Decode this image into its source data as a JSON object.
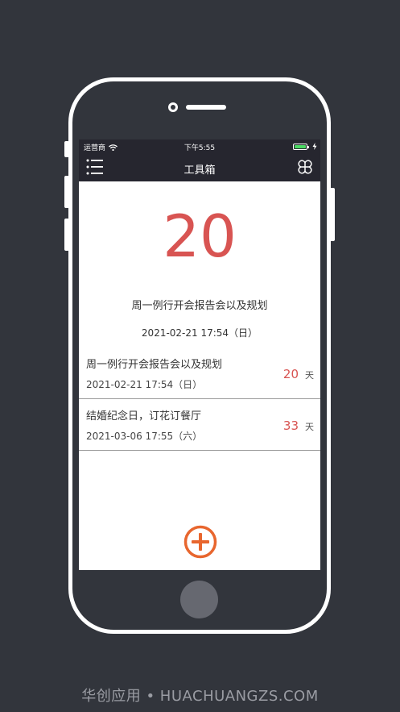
{
  "status_bar": {
    "carrier": "运营商",
    "time": "下午5:55",
    "battery_color": "#4cd964"
  },
  "nav_bar": {
    "title": "工具箱",
    "left_icon": "menu-icon",
    "right_icon": "grid-icon"
  },
  "featured": {
    "days": "20",
    "title": "周一例行开会报告会以及规划",
    "datetime": "2021-02-21 17:54（日）",
    "accent_color": "#d85452"
  },
  "events": [
    {
      "name": "周一例行开会报告会以及规划",
      "datetime": "2021-02-21 17:54（日）",
      "days": "20",
      "unit": "天"
    },
    {
      "name": "结婚纪念日，订花订餐厅",
      "datetime": "2021-03-06 17:55（六）",
      "days": "33",
      "unit": "天"
    }
  ],
  "add_button": {
    "icon": "plus-circle-icon",
    "color": "#e8662e"
  },
  "watermark": "华创应用 • HUACHUANGZS.COM"
}
